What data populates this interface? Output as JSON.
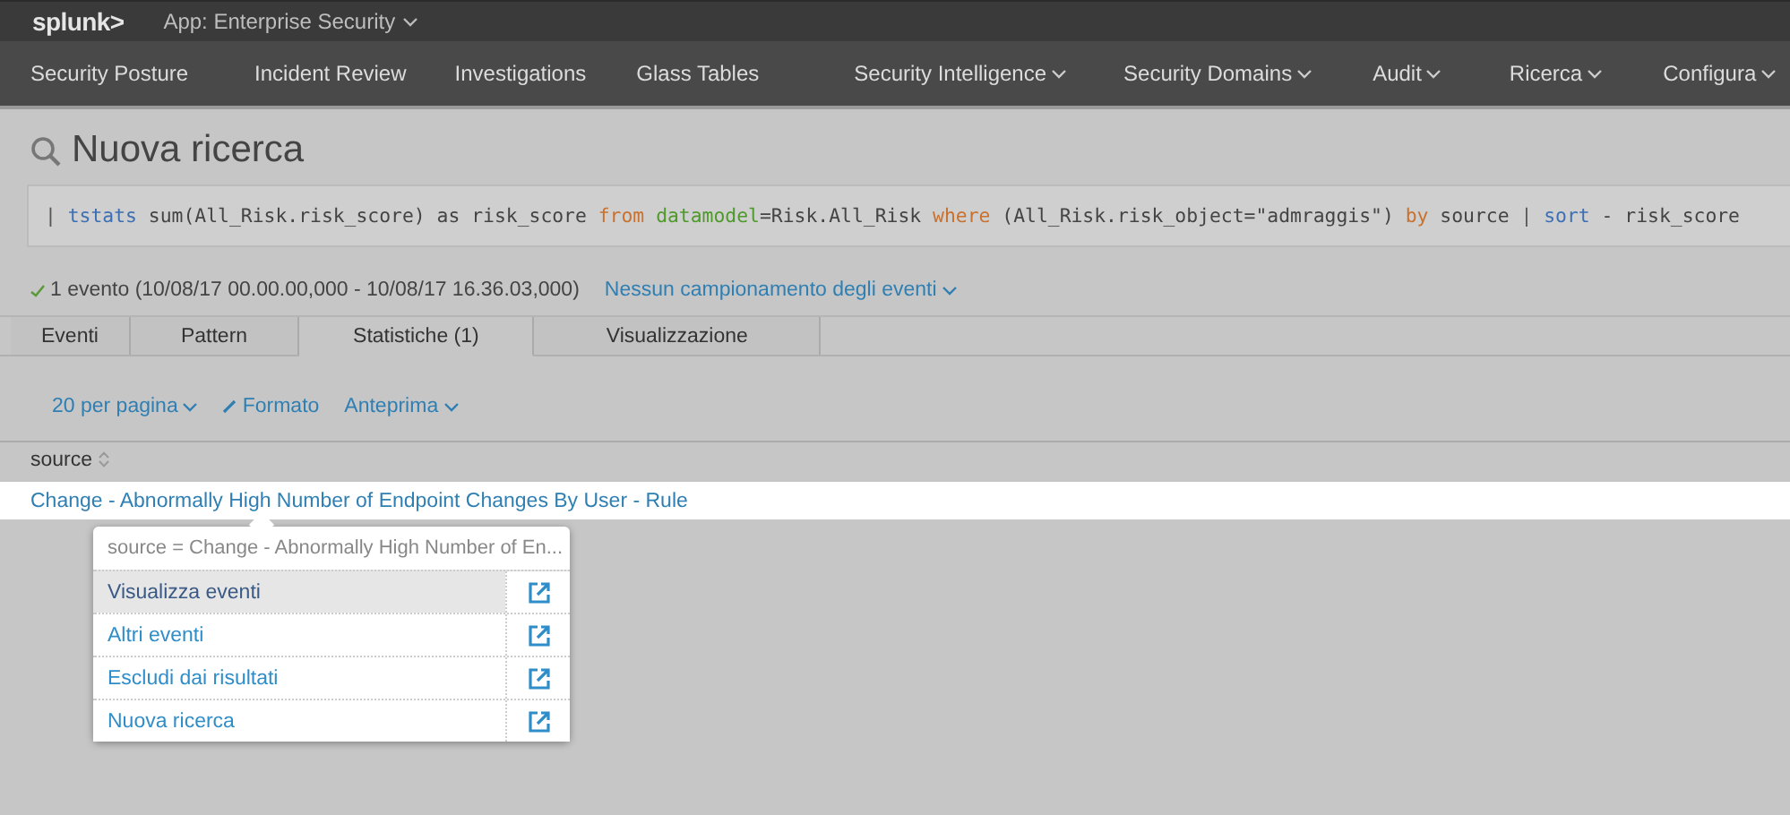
{
  "app_bar": {
    "logo": "splunk>",
    "app_menu": "App: Enterprise Security"
  },
  "nav": [
    {
      "label": "Security Posture",
      "has_menu": false
    },
    {
      "label": "Incident Review",
      "has_menu": false
    },
    {
      "label": "Investigations",
      "has_menu": false
    },
    {
      "label": "Glass Tables",
      "has_menu": false
    },
    {
      "label": "Security Intelligence",
      "has_menu": true
    },
    {
      "label": "Security Domains",
      "has_menu": true
    },
    {
      "label": "Audit",
      "has_menu": true
    },
    {
      "label": "Ricerca",
      "has_menu": true
    },
    {
      "label": "Configura",
      "has_menu": true
    }
  ],
  "page_title": "Nuova ricerca",
  "query": [
    {
      "text": "|",
      "kind": "pipe"
    },
    {
      "text": "tstats",
      "kind": "command"
    },
    {
      "text": "sum(All_Risk.risk_score) as risk_score",
      "kind": "text"
    },
    {
      "text": "from",
      "kind": "keyword"
    },
    {
      "text": "datamodel",
      "kind": "argument"
    },
    {
      "text": "=Risk.All_Risk",
      "kind": "text"
    },
    {
      "text": "where",
      "kind": "keyword"
    },
    {
      "text": "(All_Risk.risk_object=\"admraggis\")",
      "kind": "text"
    },
    {
      "text": "by",
      "kind": "keyword"
    },
    {
      "text": "source",
      "kind": "text"
    },
    {
      "text": "|",
      "kind": "pipe"
    },
    {
      "text": "sort",
      "kind": "command"
    },
    {
      "text": "- risk_score",
      "kind": "text"
    }
  ],
  "status": {
    "events": "1 evento (10/08/17 00.00.00,000 - 10/08/17 16.36.03,000)",
    "sampling": "Nessun campionamento degli eventi"
  },
  "tabs": [
    {
      "label": "Eventi",
      "selected": false
    },
    {
      "label": "Pattern",
      "selected": false
    },
    {
      "label": "Statistiche (1)",
      "selected": true
    },
    {
      "label": "Visualizzazione",
      "selected": false
    }
  ],
  "toolbar": {
    "per_page": "20 per pagina",
    "format": "Formato",
    "preview": "Anteprima"
  },
  "table": {
    "columns": [
      "source"
    ],
    "rows": [
      [
        "Change - Abnormally High Number of Endpoint Changes By User - Rule"
      ]
    ]
  },
  "popup": {
    "header": "source = Change - Abnormally High Number of En...",
    "items": [
      {
        "label": "Visualizza eventi",
        "selected": true
      },
      {
        "label": "Altri eventi",
        "selected": false
      },
      {
        "label": "Escludi dai risultati",
        "selected": false
      },
      {
        "label": "Nuova ricerca",
        "selected": false
      }
    ]
  }
}
